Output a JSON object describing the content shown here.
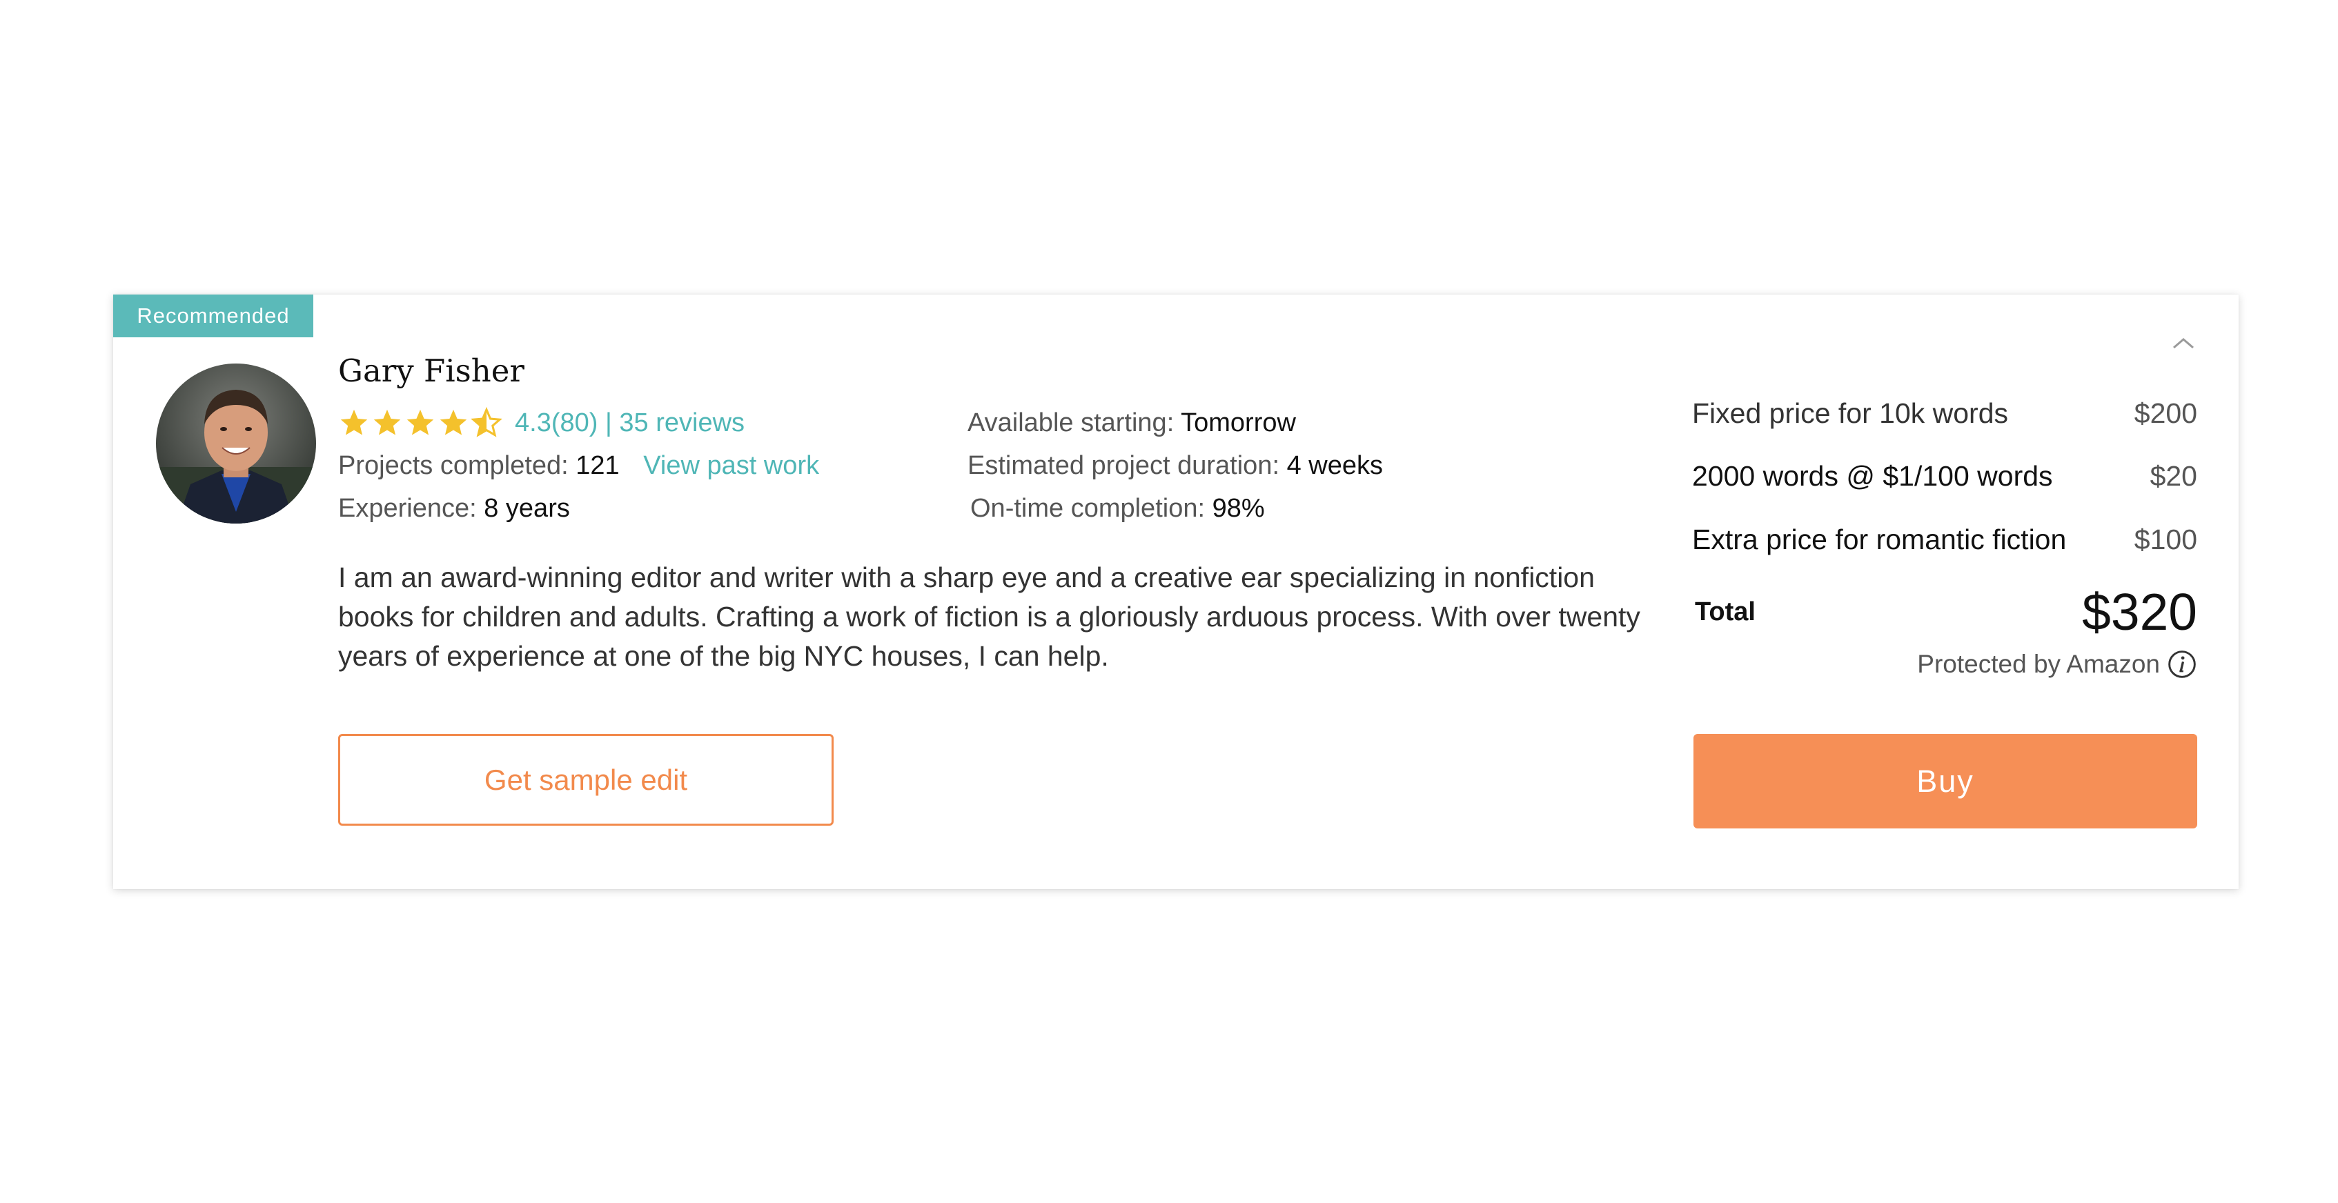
{
  "badge": "Recommended",
  "profile": {
    "name": "Gary Fisher",
    "rating_value": 4.5,
    "rating_text": "4.3(80) | 35 reviews",
    "projects_label": "Projects completed:",
    "projects_value": "121",
    "view_past_work": "View past work",
    "experience_label": "Experience:",
    "experience_value": "8 years",
    "available_label": "Available starting:",
    "available_value": "Tomorrow",
    "duration_label": "Estimated project duration:",
    "duration_value": "4 weeks",
    "ontime_label": "On-time completion:",
    "ontime_value": "98%",
    "bio": "I am an award-winning editor and writer with a sharp eye and a creative ear specializing in nonfiction books for children and adults. Crafting a work of fiction is a gloriously arduous process. With over twenty years of experience at one of the big NYC houses, I can help.",
    "sample_button": "Get sample edit"
  },
  "pricing": {
    "rows": [
      {
        "label": "Fixed price for 10k words",
        "amount": "$200"
      },
      {
        "label": "2000 words @ $1/100 words",
        "amount": "$20"
      },
      {
        "label": "Extra price for romantic fiction",
        "amount": "$100"
      }
    ],
    "total_label": "Total",
    "total_amount": "$320",
    "protected": "Protected by Amazon",
    "buy_button": "Buy"
  },
  "colors": {
    "accent_teal": "#5bbab9",
    "accent_orange": "#f68f56",
    "star": "#f4c12c"
  },
  "icons": [
    "chevron-up-icon",
    "star-icon",
    "half-star-icon",
    "info-icon"
  ]
}
